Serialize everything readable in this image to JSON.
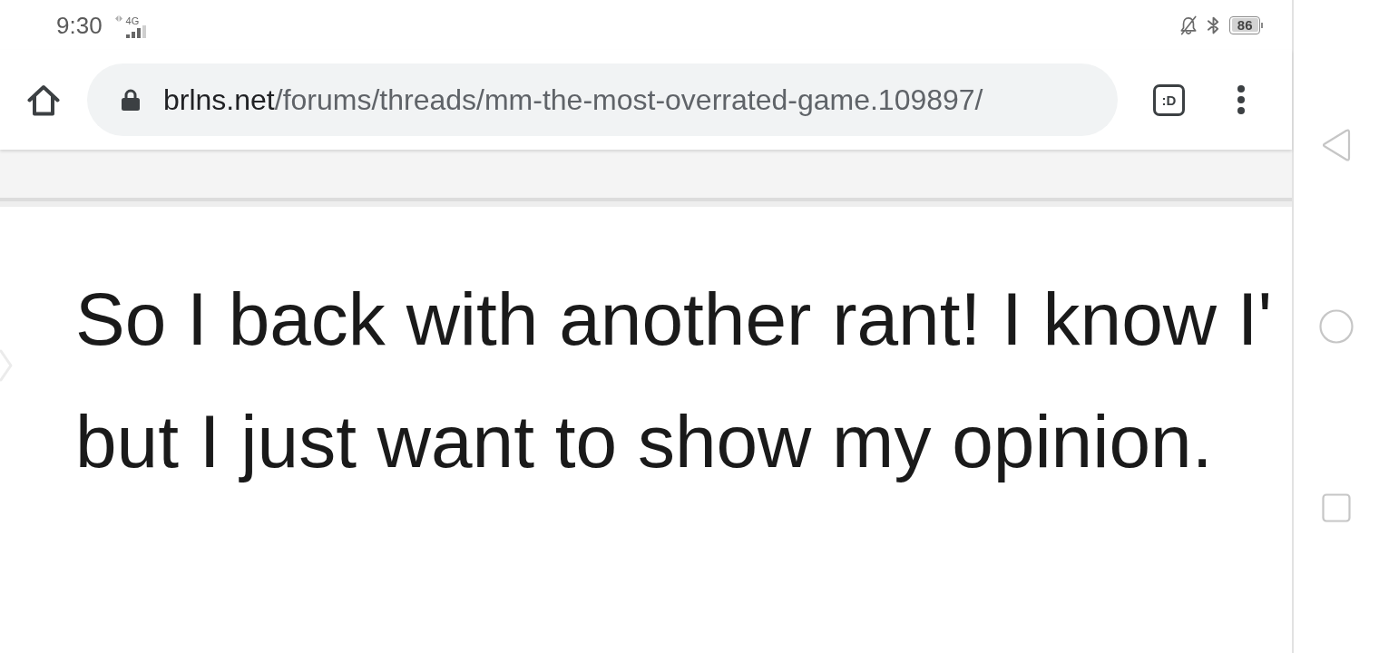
{
  "status_bar": {
    "time": "9:30",
    "network": "4G",
    "battery": "86"
  },
  "toolbar": {
    "address": {
      "host": "brlns.net",
      "path": "/forums/threads/mm-the-most-overrated-game.109897/"
    },
    "tab_switcher": ":D"
  },
  "post": {
    "lines": [
      "So I back with another rant! I know I'",
      "but I just want to show my opinion."
    ]
  }
}
